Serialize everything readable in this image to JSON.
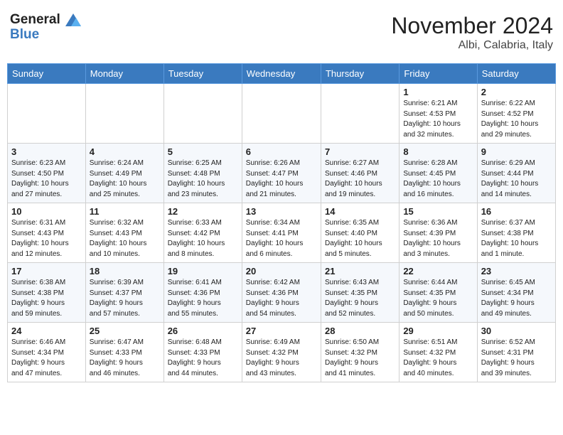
{
  "header": {
    "logo_line1": "General",
    "logo_line2": "Blue",
    "month": "November 2024",
    "location": "Albi, Calabria, Italy"
  },
  "weekdays": [
    "Sunday",
    "Monday",
    "Tuesday",
    "Wednesday",
    "Thursday",
    "Friday",
    "Saturday"
  ],
  "weeks": [
    [
      {
        "day": "",
        "info": ""
      },
      {
        "day": "",
        "info": ""
      },
      {
        "day": "",
        "info": ""
      },
      {
        "day": "",
        "info": ""
      },
      {
        "day": "",
        "info": ""
      },
      {
        "day": "1",
        "info": "Sunrise: 6:21 AM\nSunset: 4:53 PM\nDaylight: 10 hours\nand 32 minutes."
      },
      {
        "day": "2",
        "info": "Sunrise: 6:22 AM\nSunset: 4:52 PM\nDaylight: 10 hours\nand 29 minutes."
      }
    ],
    [
      {
        "day": "3",
        "info": "Sunrise: 6:23 AM\nSunset: 4:50 PM\nDaylight: 10 hours\nand 27 minutes."
      },
      {
        "day": "4",
        "info": "Sunrise: 6:24 AM\nSunset: 4:49 PM\nDaylight: 10 hours\nand 25 minutes."
      },
      {
        "day": "5",
        "info": "Sunrise: 6:25 AM\nSunset: 4:48 PM\nDaylight: 10 hours\nand 23 minutes."
      },
      {
        "day": "6",
        "info": "Sunrise: 6:26 AM\nSunset: 4:47 PM\nDaylight: 10 hours\nand 21 minutes."
      },
      {
        "day": "7",
        "info": "Sunrise: 6:27 AM\nSunset: 4:46 PM\nDaylight: 10 hours\nand 19 minutes."
      },
      {
        "day": "8",
        "info": "Sunrise: 6:28 AM\nSunset: 4:45 PM\nDaylight: 10 hours\nand 16 minutes."
      },
      {
        "day": "9",
        "info": "Sunrise: 6:29 AM\nSunset: 4:44 PM\nDaylight: 10 hours\nand 14 minutes."
      }
    ],
    [
      {
        "day": "10",
        "info": "Sunrise: 6:31 AM\nSunset: 4:43 PM\nDaylight: 10 hours\nand 12 minutes."
      },
      {
        "day": "11",
        "info": "Sunrise: 6:32 AM\nSunset: 4:43 PM\nDaylight: 10 hours\nand 10 minutes."
      },
      {
        "day": "12",
        "info": "Sunrise: 6:33 AM\nSunset: 4:42 PM\nDaylight: 10 hours\nand 8 minutes."
      },
      {
        "day": "13",
        "info": "Sunrise: 6:34 AM\nSunset: 4:41 PM\nDaylight: 10 hours\nand 6 minutes."
      },
      {
        "day": "14",
        "info": "Sunrise: 6:35 AM\nSunset: 4:40 PM\nDaylight: 10 hours\nand 5 minutes."
      },
      {
        "day": "15",
        "info": "Sunrise: 6:36 AM\nSunset: 4:39 PM\nDaylight: 10 hours\nand 3 minutes."
      },
      {
        "day": "16",
        "info": "Sunrise: 6:37 AM\nSunset: 4:38 PM\nDaylight: 10 hours\nand 1 minute."
      }
    ],
    [
      {
        "day": "17",
        "info": "Sunrise: 6:38 AM\nSunset: 4:38 PM\nDaylight: 9 hours\nand 59 minutes."
      },
      {
        "day": "18",
        "info": "Sunrise: 6:39 AM\nSunset: 4:37 PM\nDaylight: 9 hours\nand 57 minutes."
      },
      {
        "day": "19",
        "info": "Sunrise: 6:41 AM\nSunset: 4:36 PM\nDaylight: 9 hours\nand 55 minutes."
      },
      {
        "day": "20",
        "info": "Sunrise: 6:42 AM\nSunset: 4:36 PM\nDaylight: 9 hours\nand 54 minutes."
      },
      {
        "day": "21",
        "info": "Sunrise: 6:43 AM\nSunset: 4:35 PM\nDaylight: 9 hours\nand 52 minutes."
      },
      {
        "day": "22",
        "info": "Sunrise: 6:44 AM\nSunset: 4:35 PM\nDaylight: 9 hours\nand 50 minutes."
      },
      {
        "day": "23",
        "info": "Sunrise: 6:45 AM\nSunset: 4:34 PM\nDaylight: 9 hours\nand 49 minutes."
      }
    ],
    [
      {
        "day": "24",
        "info": "Sunrise: 6:46 AM\nSunset: 4:34 PM\nDaylight: 9 hours\nand 47 minutes."
      },
      {
        "day": "25",
        "info": "Sunrise: 6:47 AM\nSunset: 4:33 PM\nDaylight: 9 hours\nand 46 minutes."
      },
      {
        "day": "26",
        "info": "Sunrise: 6:48 AM\nSunset: 4:33 PM\nDaylight: 9 hours\nand 44 minutes."
      },
      {
        "day": "27",
        "info": "Sunrise: 6:49 AM\nSunset: 4:32 PM\nDaylight: 9 hours\nand 43 minutes."
      },
      {
        "day": "28",
        "info": "Sunrise: 6:50 AM\nSunset: 4:32 PM\nDaylight: 9 hours\nand 41 minutes."
      },
      {
        "day": "29",
        "info": "Sunrise: 6:51 AM\nSunset: 4:32 PM\nDaylight: 9 hours\nand 40 minutes."
      },
      {
        "day": "30",
        "info": "Sunrise: 6:52 AM\nSunset: 4:31 PM\nDaylight: 9 hours\nand 39 minutes."
      }
    ]
  ]
}
